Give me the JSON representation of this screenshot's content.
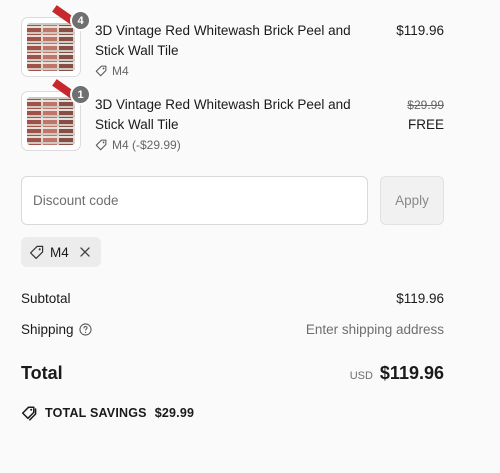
{
  "items": [
    {
      "quantity": "4",
      "title": "3D Vintage Red Whitewash Brick Peel and Stick Wall Tile",
      "discount": "M4",
      "price": "$119.96"
    },
    {
      "quantity": "1",
      "title": "3D Vintage Red Whitewash Brick Peel and Stick Wall Tile",
      "discount": "M4 (-$29.99)",
      "original_price": "$29.99",
      "price": "FREE"
    }
  ],
  "discount_form": {
    "placeholder": "Discount code",
    "value": "",
    "apply_label": "Apply"
  },
  "applied_code": "M4",
  "summary": {
    "subtotal_label": "Subtotal",
    "subtotal_value": "$119.96",
    "shipping_label": "Shipping",
    "shipping_value": "Enter shipping address",
    "total_label": "Total",
    "currency": "USD",
    "total_value": "$119.96",
    "savings_label": "TOTAL SAVINGS",
    "savings_value": "$29.99"
  },
  "icons": {
    "tag": "tag-icon",
    "close": "close-icon",
    "help": "question-circle-icon",
    "savings": "tags-icon"
  },
  "colors": {
    "badge": "#707070",
    "ribbon": "#c8282d",
    "muted": "#6e6e6e"
  }
}
